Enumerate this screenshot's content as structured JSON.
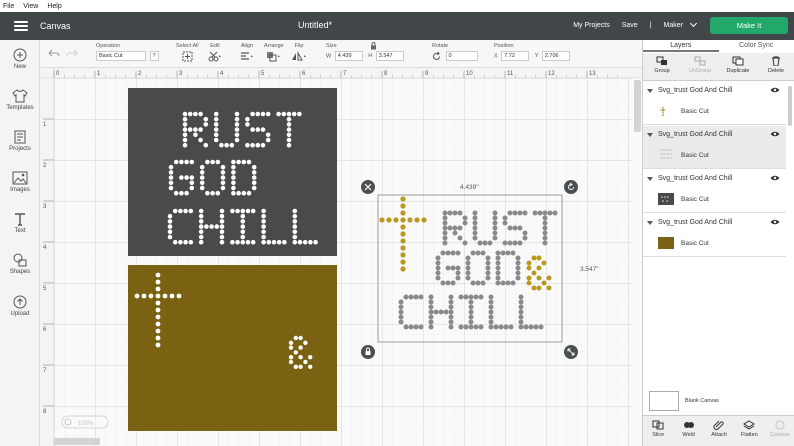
{
  "menubar": {
    "items": [
      "File",
      "View",
      "Help"
    ]
  },
  "header": {
    "app_title": "Canvas",
    "doc_title": "Untitled*",
    "my_projects": "My Projects",
    "save": "Save",
    "separator": "|",
    "machine": "Maker",
    "make_it": "Make It",
    "accent": "#22a86a"
  },
  "leftbar": {
    "items": [
      {
        "label": "New",
        "icon": "plus-icon"
      },
      {
        "label": "Templates",
        "icon": "shirt-icon"
      },
      {
        "label": "Projects",
        "icon": "projects-icon"
      },
      {
        "label": "Images",
        "icon": "image-icon"
      },
      {
        "label": "Text",
        "icon": "text-icon"
      },
      {
        "label": "Shapes",
        "icon": "shapes-icon"
      },
      {
        "label": "Upload",
        "icon": "upload-icon"
      }
    ]
  },
  "optbar": {
    "operation_label": "Operation",
    "operation_value": "Basic Cut",
    "help": "?",
    "select_all": "Select All",
    "edit": "Edit",
    "align": "Align",
    "arrange": "Arrange",
    "flip": "Flip",
    "size_label": "Size",
    "w_label": "W",
    "w_value": "4.439",
    "h_label": "H",
    "h_value": "3.547",
    "rotate_label": "Rotate",
    "rotate_value": "0",
    "position_label": "Position",
    "x_label": "X",
    "x_value": "7.72",
    "y_label": "Y",
    "y_value": "2.706"
  },
  "canvas": {
    "ruler_top": [
      "0",
      "1",
      "2",
      "3",
      "4",
      "5",
      "6",
      "7",
      "8",
      "9",
      "10",
      "11",
      "12",
      "13"
    ],
    "ruler_left": [
      "1",
      "2",
      "3",
      "4",
      "5",
      "6",
      "7",
      "8"
    ],
    "width_dim": "4.439\"",
    "height_dim": "3.547\"",
    "zoom": "100%",
    "artwork_text": [
      "RUST",
      "GOD",
      "CHILL"
    ],
    "ampersand": "&",
    "colors": {
      "dark_layer": "#4a4a4a",
      "gold_layer": "#7a6212",
      "dots_gold": "#b99a1e",
      "dots_grey": "#8a8a8a"
    }
  },
  "rpanel": {
    "tab_layers": "Layers",
    "tab_color_sync": "Color Sync",
    "actions": [
      {
        "label": "Group",
        "disabled": false
      },
      {
        "label": "UnGroup",
        "disabled": true
      },
      {
        "label": "Duplicate",
        "disabled": false
      },
      {
        "label": "Delete",
        "disabled": false
      }
    ],
    "layers": [
      {
        "name": "Svg_trust God And Chill",
        "sub": "Basic Cut"
      },
      {
        "name": "Svg_trust God And Chill",
        "sub": "Basic Cut"
      },
      {
        "name": "Svg_trust God And Chill",
        "sub": "Basic Cut"
      },
      {
        "name": "Svg_trust God And Chill",
        "sub": "Basic Cut"
      }
    ],
    "blank_canvas": "Blank Canvas",
    "bottom": [
      {
        "label": "Slice",
        "disabled": false
      },
      {
        "label": "Weld",
        "disabled": false
      },
      {
        "label": "Attach",
        "disabled": false
      },
      {
        "label": "Flatten",
        "disabled": false
      },
      {
        "label": "Contour",
        "disabled": true
      }
    ]
  }
}
